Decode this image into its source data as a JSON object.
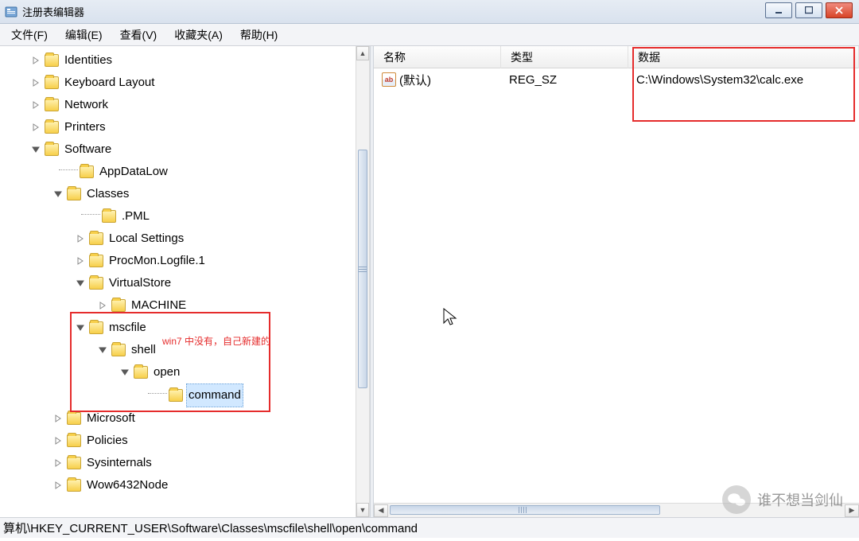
{
  "window": {
    "title": "注册表编辑器"
  },
  "menu": {
    "file": "文件(F)",
    "edit": "编辑(E)",
    "view": "查看(V)",
    "fav": "收藏夹(A)",
    "help": "帮助(H)"
  },
  "tree": {
    "n0": "Identities",
    "n1": "Keyboard Layout",
    "n2": "Network",
    "n3": "Printers",
    "n4": "Software",
    "n5": "AppDataLow",
    "n6": "Classes",
    "n7": ".PML",
    "n8": "Local Settings",
    "n9": "ProcMon.Logfile.1",
    "n10": "VirtualStore",
    "n11": "MACHINE",
    "n12": "mscfile",
    "n13": "shell",
    "n14": "open",
    "n15": "command",
    "n16": "Microsoft",
    "n17": "Policies",
    "n18": "Sysinternals",
    "n19": "Wow6432Node"
  },
  "annotation": "win7 中没有，自己新建的",
  "list": {
    "col_name": "名称",
    "col_type": "类型",
    "col_data": "数据",
    "row0_name": "(默认)",
    "row0_type": "REG_SZ",
    "row0_data": "C:\\Windows\\System32\\calc.exe"
  },
  "statusbar": "算机\\HKEY_CURRENT_USER\\Software\\Classes\\mscfile\\shell\\open\\command",
  "watermark": "谁不想当剑仙"
}
